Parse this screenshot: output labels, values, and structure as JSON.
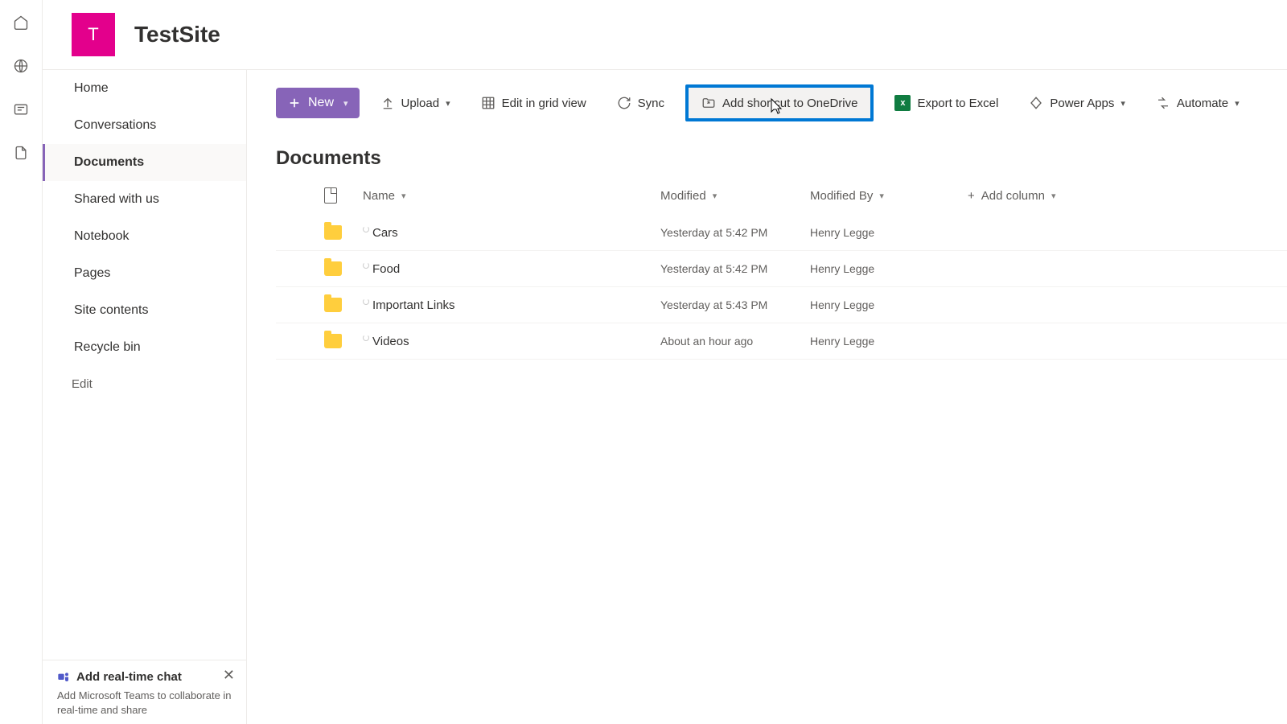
{
  "site": {
    "badge": "T",
    "title": "TestSite"
  },
  "rail": [
    {
      "name": "home-icon"
    },
    {
      "name": "globe-icon"
    },
    {
      "name": "news-icon"
    },
    {
      "name": "document-icon"
    }
  ],
  "nav": {
    "items": [
      {
        "label": "Home",
        "active": false
      },
      {
        "label": "Conversations",
        "active": false
      },
      {
        "label": "Documents",
        "active": true
      },
      {
        "label": "Shared with us",
        "active": false
      },
      {
        "label": "Notebook",
        "active": false
      },
      {
        "label": "Pages",
        "active": false
      },
      {
        "label": "Site contents",
        "active": false
      },
      {
        "label": "Recycle bin",
        "active": false
      }
    ],
    "edit_label": "Edit"
  },
  "callout": {
    "title": "Add real-time chat",
    "body": "Add Microsoft Teams to collaborate in real-time and share"
  },
  "toolbar": {
    "new_label": "New",
    "upload_label": "Upload",
    "grid_label": "Edit in grid view",
    "sync_label": "Sync",
    "shortcut_label": "Add shortcut to OneDrive",
    "export_label": "Export to Excel",
    "powerapps_label": "Power Apps",
    "automate_label": "Automate"
  },
  "library": {
    "title": "Documents",
    "columns": {
      "name": "Name",
      "modified": "Modified",
      "modified_by": "Modified By",
      "add_column": "Add column"
    },
    "rows": [
      {
        "name": "Cars",
        "modified": "Yesterday at 5:42 PM",
        "modified_by": "Henry Legge"
      },
      {
        "name": "Food",
        "modified": "Yesterday at 5:42 PM",
        "modified_by": "Henry Legge"
      },
      {
        "name": "Important Links",
        "modified": "Yesterday at 5:43 PM",
        "modified_by": "Henry Legge"
      },
      {
        "name": "Videos",
        "modified": "About an hour ago",
        "modified_by": "Henry Legge"
      }
    ]
  }
}
